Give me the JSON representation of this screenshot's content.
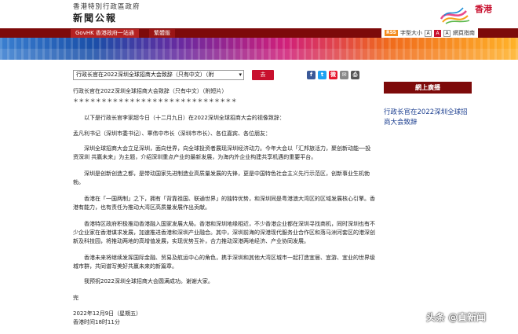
{
  "header": {
    "gov_name": "香港特別行政區政府",
    "site_title": "新聞公報",
    "brand": "香港"
  },
  "nav": {
    "tabs": [
      "GovHK 香港政府一站通",
      "繁體版"
    ]
  },
  "utilities": {
    "rss": "RSS",
    "font_size_label": "字型大小",
    "sizes": [
      "A",
      "A",
      "A"
    ],
    "site_guide": "網頁指南"
  },
  "toolbar": {
    "select_value": "行政长官在2022深圳全球招商大会致辞（只有中文）（附",
    "go_label": "去"
  },
  "share_icons": [
    {
      "glyph": "f",
      "color": "#3b5998",
      "name": "facebook-icon"
    },
    {
      "glyph": "t",
      "color": "#1da1f2",
      "name": "twitter-icon"
    },
    {
      "glyph": "微",
      "color": "#e6162d",
      "name": "weibo-icon"
    },
    {
      "glyph": "✉",
      "color": "#888888",
      "name": "email-icon"
    },
    {
      "glyph": "⎙",
      "color": "#555555",
      "name": "print-icon"
    }
  ],
  "article": {
    "title": "行政长官在2022深圳全球招商大会致辞（只有中文）（附短片）",
    "stars": "＊＊＊＊＊＊＊＊＊＊＊＊＊＊＊＊＊＊＊＊＊＊＊＊＊＊＊＊＊",
    "paragraphs": [
      "以下是行政长官李家超今日（十二月九日）在2022深圳全球招商大会的视像致辞：",
      "孟凡利书记（深圳市委书记）、覃伟中市长（深圳市市长）、各位嘉宾、各位朋友：",
      "深圳全球招商大会立足深圳，面向世界，向全球投资者展现深圳经济动力。今年大会以「汇邦旅活力，聚创新动能──投资深圳 共赢未来」为主题，介绍深圳重点产业的最新发展，为海内外企业构建共享机遇的重要平台。",
      "深圳是创新创造之都，是带动国家先进制造业高质量发展的先锋，更是中国特色社会主义先行示范区，创新事业生机勃勃。",
      "香港在「一国两制」之下，拥有「背靠祖国、联通世界」的独特优势，和深圳同是粤港澳大湾区的区域发展核心引擎。香港有能力，也有责任为推动大湾区高质量发展作出贡献。",
      "香港特区政府积极推动香港融入国家发展大局。香港和深圳地缘相近，不少香港企业都在深圳寻找商机，同时深圳也有不少企业家在香港谋求发展，加速推进香港和深圳产业融合。其中，深圳前海的深港现代服务业合作区和落马洲河套区的港深创新及科技园，将推动两地的高增值发展，实现优势互补，合力推动深港两地经济、产业协同发展。",
      "香港未来将继续发挥国际金融、贸易及航运中心的角色，携手深圳和其他大湾区城市一起打造宜居、宜游、宜业的世界级城市群，共同谱写美好共赢未来的新篇章。",
      "我预祝2022深圳全球招商大会圆满成功。谢谢大家。",
      "完"
    ],
    "date": "2022年12月9日（星期五）",
    "time": "香港时间18时11分"
  },
  "sidebar": {
    "heading": "網上廣播",
    "link": "行政长官在2022深圳全球招商大会致辞"
  },
  "watermark": "头条 @直新闻"
}
